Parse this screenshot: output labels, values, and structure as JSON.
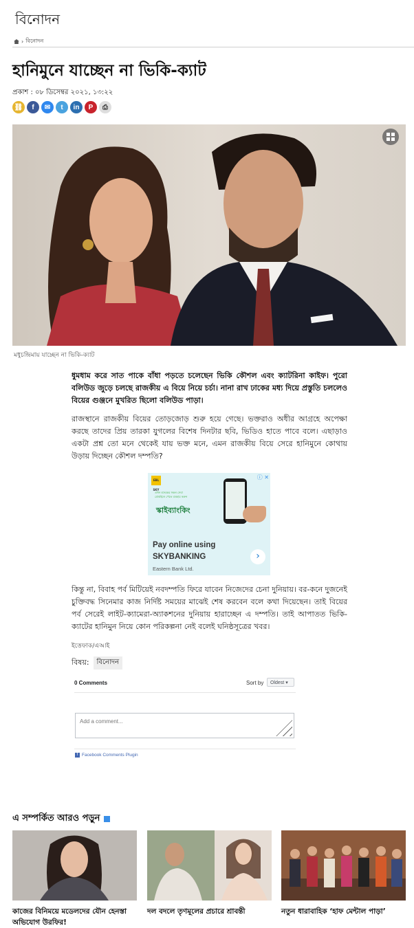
{
  "section": "বিনোদন",
  "breadcrumb": {
    "current": "বিনোদন"
  },
  "headline": "হানিমুনে যাচ্ছেন না ভিকি-ক্যাট",
  "published": "প্রকাশ : ০৮ ডিসেম্বর ২০২১, ১৩:২২",
  "share_icons": [
    "link-icon",
    "facebook-icon",
    "messenger-icon",
    "twitter-icon",
    "linkedin-icon",
    "pinterest-icon",
    "print-icon"
  ],
  "caption": "মধুচন্দ্রিমায় যাচ্ছেন না ভিকি-ক্যাট",
  "lead": "ধুমধাম করে সাত পাকে বাঁধা পড়তে চলেছেন ভিকি কৌশল এবং ক্যাটরিনা কাইফ। পুরো বলিউড জুড়ে চলছে রাজকীয় এ বিয়ে নিয়ে চর্চা। নানা রাখ ঢাকের মধ্য দিয়ে প্রস্তুতি চললেও বিয়ের গুঞ্জনে মুখরিত ছিলো  বলিউড পাড়া।",
  "para2": "রাজস্থানে রাজকীয় বিয়ের তোড়জোড় শুরু হয়ে গেছে। ভক্তরাও অধীর আগ্রহে অপেক্ষা করছে তাদের প্রিয় তারকা যুগলের বিশেষ দিনটার ছবি, ভিডিও হাতে পাবে বলে। এছাড়াও একটা প্রশ্ন তো মনে থেকেই যায় ভক্ত মনে, এমন রাজকীয় বিয়ে সেরে হানিমুনে কোথায় উড়ায় দিচ্ছেন কৌশল দম্পতি?",
  "para3": "কিন্তু না, বিবাহ পর্ব মিটিয়েই নবদম্পতি ফিরে যাবেন নিজেদের চেনা দুনিয়ায়। বর-কনে দুজনেই চুক্তিবদ্ধ সিনেমার কাজ নির্দিষ্ট সময়ের মাঝেই শেষ করবেন বলে কথা দিয়েছেন। তাই বিয়ের পর্ব সেরেই লাইট-ক্যামেরা-অ্যাকশনের দুনিয়ায় হারাচ্ছেন এ দম্পতি। তাই আপাতত ভিকি-ক্যাটের হানিমুন নিয়ে কোন পরিকল্পনা নেই বলেই ঘনিষ্ঠসূত্রের খবর।",
  "ad": {
    "brand": "EBL SKY",
    "small_text": "এখন ব্যাংকের সকল সেবা\nমোবাইলে পেতে ব্যবহার করুন",
    "bangla_title": "স্কাইব্যাংকিং",
    "headline": "Pay online using\nSKYBANKING",
    "advertiser": "Eastern Bank Ltd."
  },
  "source": "ইত্তেফাক/এআই",
  "topic": {
    "label": "বিষয়:",
    "tag": "বিনোদন"
  },
  "comments": {
    "count": "0 Comments",
    "sort_label": "Sort by",
    "sort_value": "Oldest",
    "placeholder": "Add a comment...",
    "plugin": "Facebook Comments Plugin"
  },
  "related": {
    "title": "এ সম্পর্কিত আরও পড়ুন",
    "items": [
      {
        "title": "কাজের বিনিময়ে মডেলদের যৌন হেনস্তা অভিযোগ উরফির!"
      },
      {
        "title": "দল বদলে তৃণমূলের প্রচারে শ্রাবন্তী"
      },
      {
        "title": "নতুন ধারাবাহিক ‘হাফ মেন্টাল পাড়া’"
      }
    ]
  }
}
